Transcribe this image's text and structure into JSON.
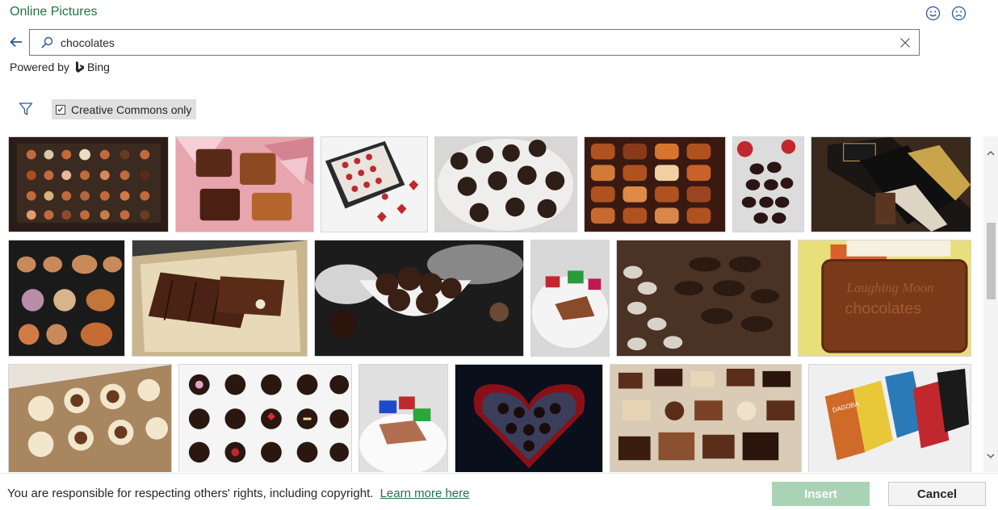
{
  "dialog": {
    "title": "Online Pictures"
  },
  "feedback": {
    "smile_icon": "smiley-face-icon",
    "frown_icon": "frown-face-icon"
  },
  "search": {
    "value": "chocolates",
    "icon": "search-icon",
    "clear_icon": "close-icon"
  },
  "powered_by": {
    "label": "Powered by",
    "brand": "Bing"
  },
  "filter": {
    "icon": "filter-icon",
    "creative_commons_label": "Creative Commons only",
    "creative_commons_checked": true
  },
  "results": [
    {
      "row": 1,
      "alt": "Box of assorted chocolates in tray"
    },
    {
      "row": 1,
      "alt": "Chocolates with pink crystals"
    },
    {
      "row": 1,
      "alt": "Box of red chocolates with hearts"
    },
    {
      "row": 1,
      "alt": "Truffles on white plate"
    },
    {
      "row": 1,
      "alt": "Tray of filled chocolates"
    },
    {
      "row": 1,
      "alt": "Dark chocolate pralines with flowers"
    },
    {
      "row": 1,
      "alt": "Chocolate bars 70% dark and milk"
    },
    {
      "row": 2,
      "alt": "Cookies in dark tray"
    },
    {
      "row": 2,
      "alt": "Chocolate bar pieces on board"
    },
    {
      "row": 2,
      "alt": "Truffles in white bowl"
    },
    {
      "row": 2,
      "alt": "Wrapped chocolates on plate"
    },
    {
      "row": 2,
      "alt": "Shell shaped chocolates"
    },
    {
      "row": 2,
      "alt": "Laughing Moon chocolates bar",
      "text": "Laughing Moon chocolates"
    },
    {
      "row": 3,
      "alt": "Chocolates in paper cups"
    },
    {
      "row": 3,
      "alt": "Decorated chocolate bonbons"
    },
    {
      "row": 3,
      "alt": "Wrapped chocolate squares"
    },
    {
      "row": 3,
      "alt": "Heart shaped chocolate box"
    },
    {
      "row": 3,
      "alt": "Assorted chocolate squares"
    },
    {
      "row": 3,
      "alt": "Dagoba chocolate bars",
      "text": "DAGOBA"
    }
  ],
  "footer": {
    "notice": "You are responsible for respecting others' rights, including copyright.",
    "learn_more": "Learn more here",
    "insert_label": "Insert",
    "cancel_label": "Cancel"
  },
  "colors": {
    "accent": "#217346",
    "insert_disabled": "#a9d3b4"
  }
}
